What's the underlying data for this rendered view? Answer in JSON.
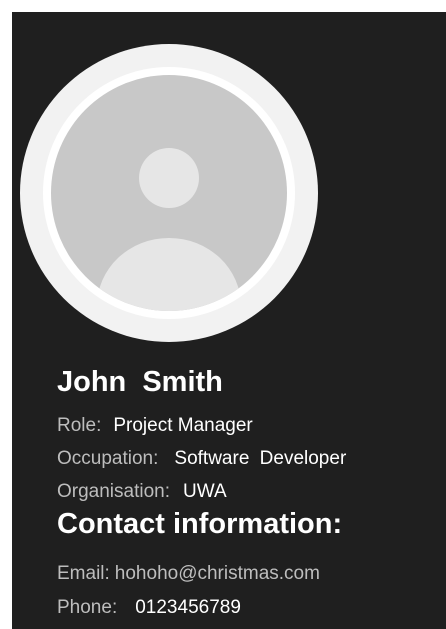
{
  "profile": {
    "name": "John  Smith",
    "fields": {
      "role": {
        "label": "Role:",
        "value": "Project Manager"
      },
      "occupation": {
        "label": "Occupation:",
        "value": "Software  Developer"
      },
      "organisation": {
        "label": "Organisation:",
        "value": "UWA"
      }
    }
  },
  "contact": {
    "heading": "Contact information:",
    "email": {
      "label": "Email:",
      "value": "hohoho@christmas.com"
    },
    "phone": {
      "label": "Phone:",
      "value": "0123456789"
    }
  },
  "colors": {
    "card_background": "#1f1f1f",
    "page_background": "#ffffff",
    "avatar_ring": "#f2f2f2",
    "avatar_fill": "#c8c8c8",
    "avatar_silhouette": "#e6e6e6",
    "label_text": "#bdbdbd",
    "value_text": "#ffffff"
  },
  "icons": {
    "avatar": "default-user-avatar-icon"
  }
}
